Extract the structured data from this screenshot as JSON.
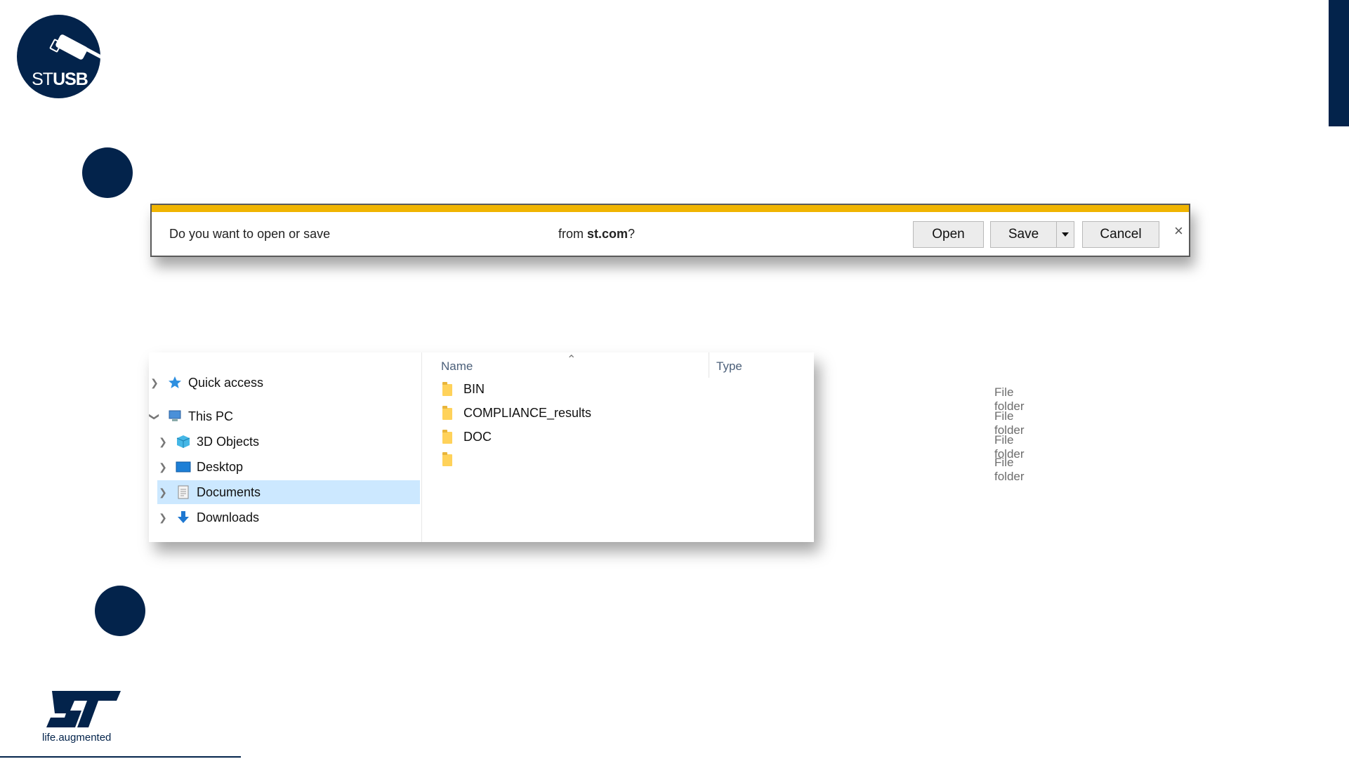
{
  "logo": {
    "text_st": "ST",
    "text_usb": "USB",
    "brand_color": "#03234b"
  },
  "download_bar": {
    "message_prefix": "Do you want to open or save",
    "message_from": "from ",
    "site": "st.com",
    "message_suffix": "?",
    "open_label": "Open",
    "save_label": "Save",
    "cancel_label": "Cancel",
    "accent_color": "#f0b400"
  },
  "explorer": {
    "nav": [
      {
        "label": "Quick access",
        "icon": "star-icon",
        "expanded": false
      },
      {
        "label": "This PC",
        "icon": "computer-icon",
        "expanded": true
      },
      {
        "label": "3D Objects",
        "icon": "cube-icon",
        "expanded": false
      },
      {
        "label": "Desktop",
        "icon": "desktop-icon",
        "expanded": false
      },
      {
        "label": "Documents",
        "icon": "document-icon",
        "expanded": false,
        "selected": true
      },
      {
        "label": "Downloads",
        "icon": "download-arrow-icon",
        "expanded": false
      }
    ],
    "columns": {
      "name": "Name",
      "type": "Type"
    },
    "files": [
      {
        "name": "BIN",
        "type": "File folder"
      },
      {
        "name": "COMPLIANCE_results",
        "type": "File folder"
      },
      {
        "name": "DOC",
        "type": "File folder"
      },
      {
        "name": "",
        "type": "File folder"
      }
    ]
  },
  "footer": {
    "tagline": "life.augmented"
  }
}
